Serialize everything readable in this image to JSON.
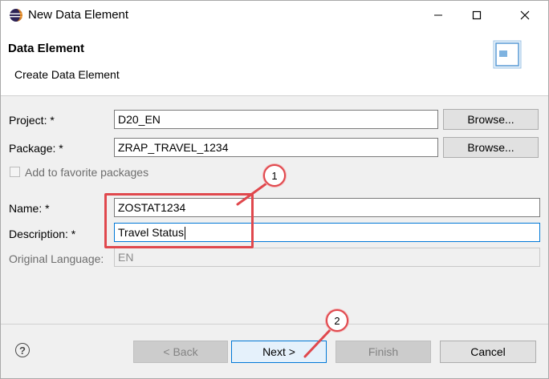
{
  "window": {
    "title": "New Data Element"
  },
  "banner": {
    "title": "Data Element",
    "subtitle": "Create Data Element"
  },
  "form": {
    "project_label": "Project: *",
    "project_value": "D20_EN",
    "package_label": "Package: *",
    "package_value": "ZRAP_TRAVEL_1234",
    "browse_label": "Browse...",
    "favorite_label": "Add to favorite packages",
    "name_label": "Name: *",
    "name_value": "ZOSTAT1234",
    "description_label": "Description: *",
    "description_value": "Travel Status",
    "language_label": "Original Language:",
    "language_value": "EN"
  },
  "footer": {
    "help_symbol": "?",
    "back_label": "< Back",
    "next_label": "Next >",
    "finish_label": "Finish",
    "cancel_label": "Cancel"
  },
  "annotations": {
    "callout_1": "1",
    "callout_2": "2",
    "color": "#e0484d"
  },
  "icons": {
    "app": "eclipse-icon",
    "minimize": "minimize-icon",
    "maximize": "maximize-icon",
    "close": "close-icon",
    "wizard": "data-element-wizard-icon",
    "help": "help-icon"
  }
}
